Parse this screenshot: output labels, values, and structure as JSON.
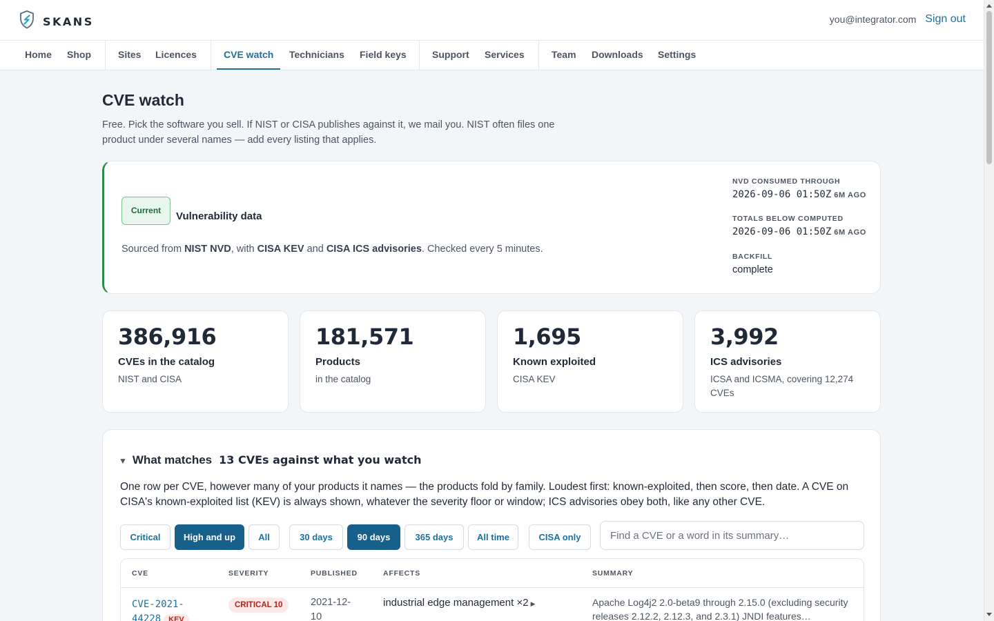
{
  "brand": {
    "name": "SKANS"
  },
  "account": {
    "email": "you@integrator.com",
    "signout": "Sign out"
  },
  "nav": {
    "items": [
      "Home",
      "Shop",
      "Sites",
      "Licences",
      "CVE watch",
      "Technicians",
      "Field keys",
      "Support",
      "Services",
      "Team",
      "Downloads",
      "Settings"
    ],
    "active": "CVE watch"
  },
  "page": {
    "title": "CVE watch",
    "intro": "Free. Pick the software you sell. If NIST or CISA publishes against it, we mail you. NIST often files one product under several names — add every listing that applies."
  },
  "status": {
    "badge": "Current",
    "title": "Vulnerability data",
    "desc": {
      "p1": "Sourced from ",
      "nvd": "NIST NVD",
      "p2": ", with ",
      "kev": "CISA KEV",
      "p3": " and ",
      "ics": "CISA ICS advisories",
      "p4": ". Checked every 5 minutes."
    },
    "meta": [
      {
        "label": "NVD CONSUMED THROUGH",
        "value": "2026-09-06 01:50Z",
        "ago": "6M AGO"
      },
      {
        "label": "TOTALS BELOW COMPUTED",
        "value": "2026-09-06 01:50Z",
        "ago": "6M AGO"
      },
      {
        "label": "BACKFILL",
        "value": "complete"
      }
    ]
  },
  "stats": [
    {
      "value": "386,916",
      "label": "CVEs in the catalog",
      "sub": "NIST and CISA"
    },
    {
      "value": "181,571",
      "label": "Products",
      "sub": "in the catalog"
    },
    {
      "value": "1,695",
      "label": "Known exploited",
      "sub": "CISA KEV"
    },
    {
      "value": "3,992",
      "label": "ICS advisories",
      "sub": "ICSA and ICSMA, covering 12,274 CVEs"
    }
  ],
  "matches": {
    "caret": "▼",
    "title": "What matches",
    "count": "13 CVEs against what you watch",
    "desc": "One row per CVE, however many of your products it names — the products fold by family. Loudest first: known-exploited, then score, then date. A CVE on CISA's known-exploited list (KEV) is always shown, whatever the severity floor or window; ICS advisories obey both, like any other CVE.",
    "filters": {
      "severity": [
        "Critical",
        "High and up",
        "All"
      ],
      "severity_selected": "High and up",
      "window": [
        "30 days",
        "90 days",
        "365 days",
        "All time"
      ],
      "window_selected": "90 days",
      "source": "CISA only"
    },
    "search_placeholder": "Find a CVE or a word in its summary…",
    "columns": [
      "CVE",
      "SEVERITY",
      "PUBLISHED",
      "AFFECTS",
      "SUMMARY"
    ],
    "rows": [
      {
        "cve": "CVE-2021-44228",
        "kev": "KEV",
        "severity": "CRITICAL 10",
        "published": "2021-12-10",
        "affects": "industrial edge management ×2",
        "summary": "Apache Log4j2 2.0-beta9 through 2.15.0 (excluding security releases 2.12.2, 2.12.3, and 2.3.1) JNDI features…"
      }
    ]
  },
  "colors": {
    "accent": "#1f6f9c",
    "accent_dark": "#17608c",
    "success": "#2e8a4c",
    "danger": "#b42318",
    "page_bg": "#f3f6f8"
  }
}
